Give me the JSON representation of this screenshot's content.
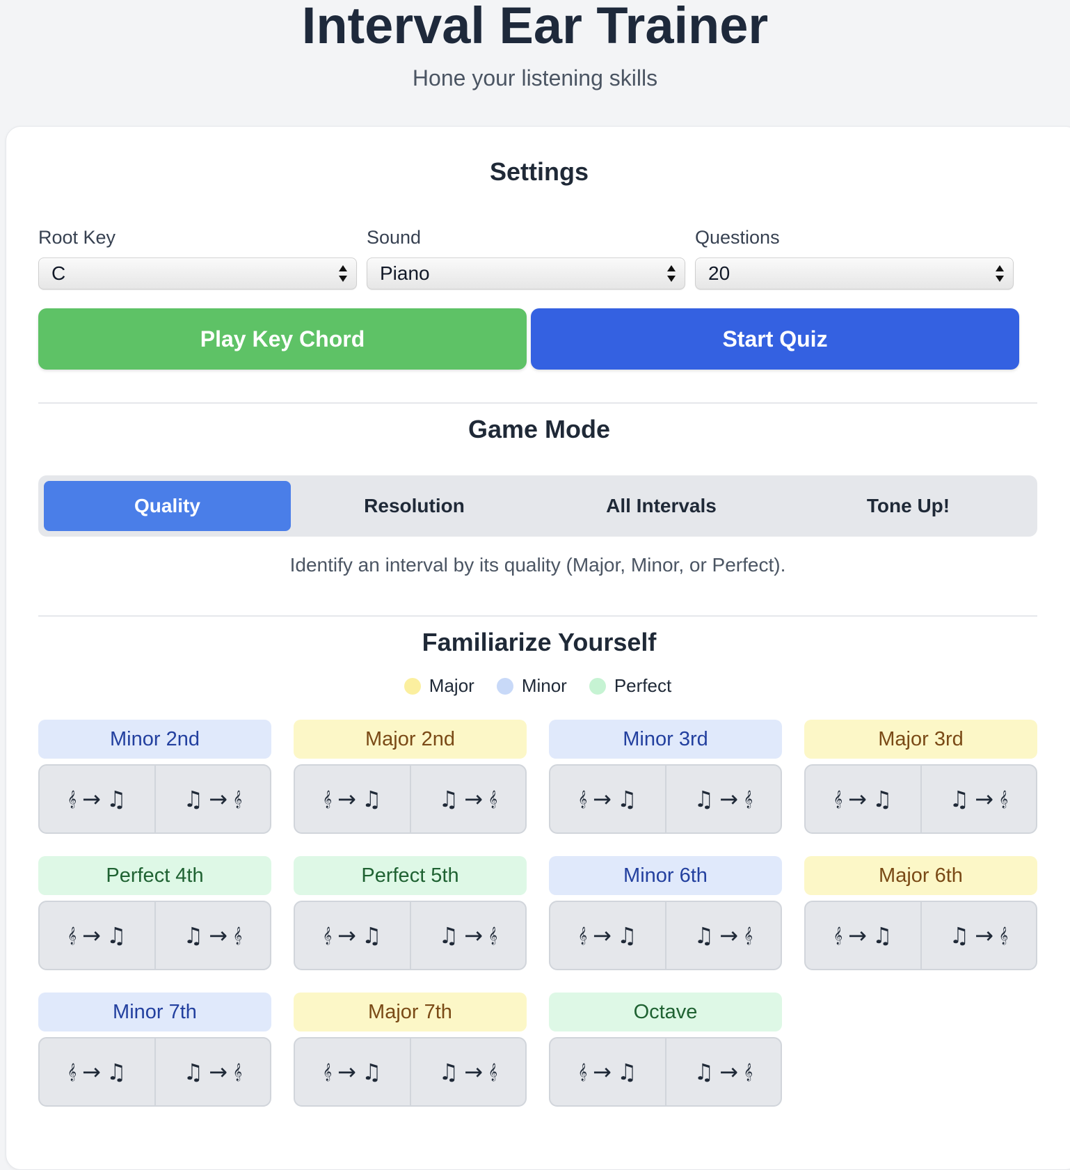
{
  "header": {
    "title": "Interval Ear Trainer",
    "subtitle": "Hone your listening skills"
  },
  "settings": {
    "title": "Settings",
    "root_key": {
      "label": "Root Key",
      "value": "C"
    },
    "sound": {
      "label": "Sound",
      "value": "Piano"
    },
    "questions": {
      "label": "Questions",
      "value": "20"
    },
    "play_button": "Play Key Chord",
    "start_button": "Start Quiz",
    "colors": {
      "play": "#5ec266",
      "start": "#3461e1"
    }
  },
  "game_mode": {
    "title": "Game Mode",
    "tabs": [
      {
        "label": "Quality",
        "active": true
      },
      {
        "label": "Resolution",
        "active": false
      },
      {
        "label": "All Intervals",
        "active": false
      },
      {
        "label": "Tone Up!",
        "active": false
      }
    ],
    "description": "Identify an interval by its quality (Major, Minor, or Perfect)."
  },
  "familiarize": {
    "title": "Familiarize Yourself",
    "legend": [
      {
        "label": "Major",
        "color": "#fbef9f"
      },
      {
        "label": "Minor",
        "color": "#c8d9f8"
      },
      {
        "label": "Perfect",
        "color": "#c6f3d3"
      }
    ],
    "button_glyphs": {
      "ascending": {
        "from": "𝄞",
        "arrow": "→",
        "to": "♫"
      },
      "descending": {
        "from": "♫",
        "arrow": "→",
        "to": "𝄞"
      }
    },
    "intervals": [
      {
        "name": "Minor 2nd",
        "quality": "minor"
      },
      {
        "name": "Major 2nd",
        "quality": "major"
      },
      {
        "name": "Minor 3rd",
        "quality": "minor"
      },
      {
        "name": "Major 3rd",
        "quality": "major"
      },
      {
        "name": "Perfect 4th",
        "quality": "perfect"
      },
      {
        "name": "Perfect 5th",
        "quality": "perfect"
      },
      {
        "name": "Minor 6th",
        "quality": "minor"
      },
      {
        "name": "Major 6th",
        "quality": "major"
      },
      {
        "name": "Minor 7th",
        "quality": "minor"
      },
      {
        "name": "Major 7th",
        "quality": "major"
      },
      {
        "name": "Octave",
        "quality": "perfect"
      }
    ]
  }
}
